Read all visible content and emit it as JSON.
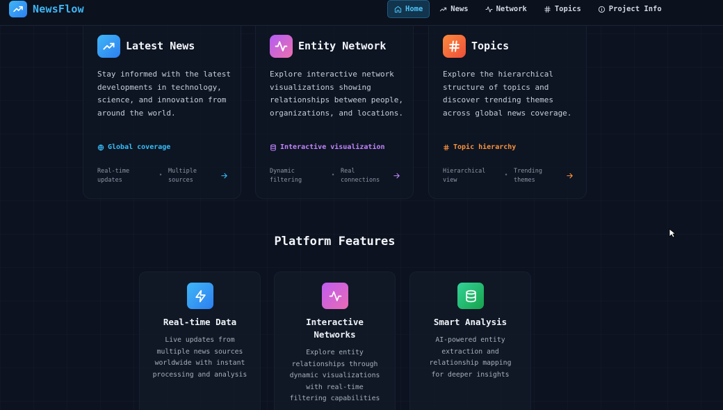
{
  "brand": {
    "name": "NewsFlow",
    "icon": "trending-up-icon"
  },
  "nav": [
    {
      "label": "Home",
      "icon": "home-icon",
      "active": true
    },
    {
      "label": "News",
      "icon": "trending-up-icon"
    },
    {
      "label": "Network",
      "icon": "activity-icon"
    },
    {
      "label": "Topics",
      "icon": "hash-icon"
    },
    {
      "label": "Project Info",
      "icon": "info-icon"
    }
  ],
  "cards": [
    {
      "title": "Latest News",
      "icon": "trending-up-icon",
      "description": "Stay informed with the latest developments in technology, science, and innovation from around the world.",
      "tag": "Global coverage",
      "tag_icon": "globe-icon",
      "tag_color": "#38bdf8",
      "foot_a": "Real-time updates",
      "foot_b": "Multiple sources",
      "foot_dot": "•"
    },
    {
      "title": "Entity Network",
      "icon": "activity-icon",
      "description": "Explore interactive network visualizations showing relationships between people, organizations, and locations.",
      "tag": "Interactive visualization",
      "tag_icon": "database-icon",
      "tag_color": "#c084fc",
      "foot_a": "Dynamic filtering",
      "foot_b": "Real connections",
      "foot_dot": "•"
    },
    {
      "title": "Topics",
      "icon": "hash-icon",
      "description": "Explore the hierarchical structure of topics and discover trending themes across global news coverage.",
      "tag": "Topic hierarchy",
      "tag_icon": "hash-icon",
      "tag_color": "#fb923c",
      "foot_a": "Hierarchical view",
      "foot_b": "Trending themes",
      "foot_dot": "•"
    }
  ],
  "section": {
    "title": "Platform Features"
  },
  "features": [
    {
      "title": "Real-time Data",
      "icon": "zap-icon",
      "description": "Live updates from multiple news sources worldwide with instant processing and analysis"
    },
    {
      "title": "Interactive Networks",
      "icon": "activity-icon",
      "description": "Explore entity relationships through dynamic visualizations with real-time filtering capabilities"
    },
    {
      "title": "Smart Analysis",
      "icon": "database-icon",
      "description": "AI-powered entity extraction and relationship mapping for deeper insights"
    }
  ],
  "colors": {
    "background": "#0c1220",
    "accent": "#3fb6f6",
    "nav_active_bg": "#12344d",
    "blue_gradient": [
      "#3fb6f6",
      "#2d7ff0"
    ],
    "purple_gradient": [
      "#c05cf0",
      "#e86bb4"
    ],
    "orange_gradient": [
      "#fb8a3c",
      "#ef4e3a"
    ],
    "green_gradient": [
      "#34d399",
      "#16a34a"
    ]
  }
}
